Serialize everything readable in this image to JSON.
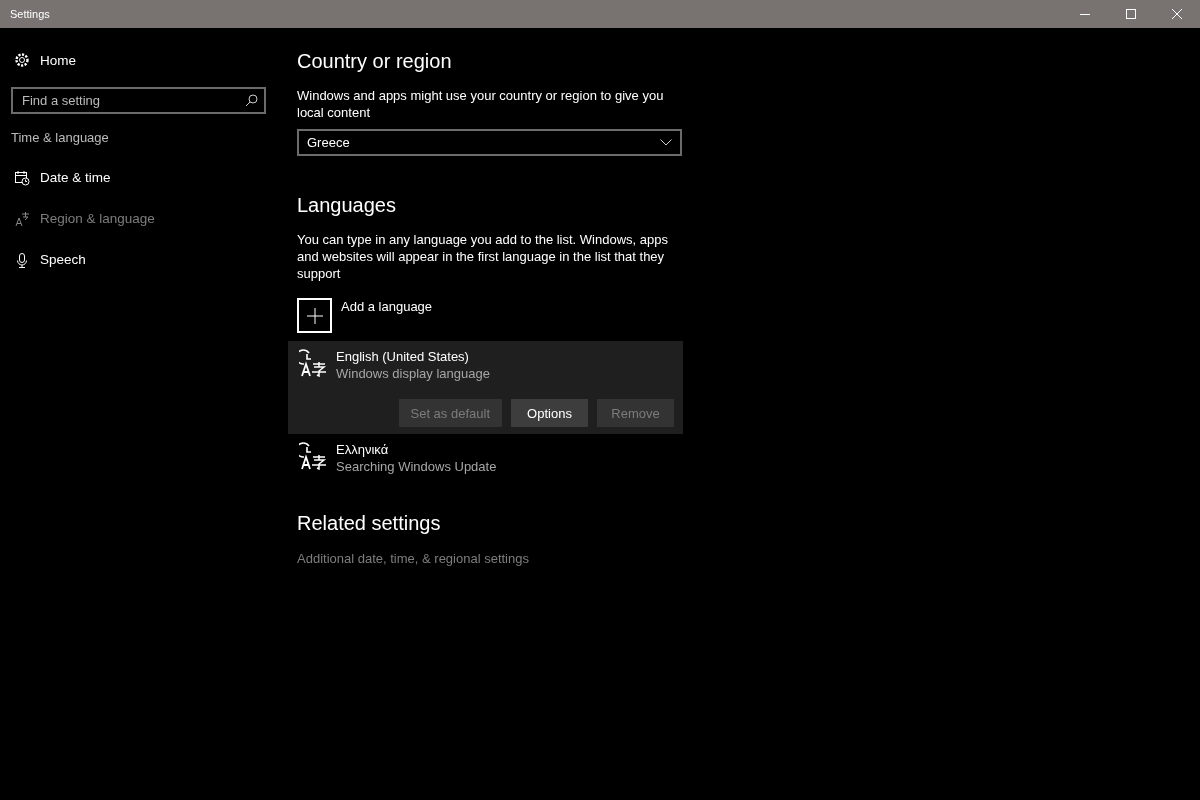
{
  "window": {
    "title": "Settings"
  },
  "sidebar": {
    "home": "Home",
    "search": {
      "placeholder": "Find a setting"
    },
    "section": "Time & language",
    "items": [
      {
        "label": "Date & time",
        "kind": "date",
        "selected": false
      },
      {
        "label": "Region & language",
        "kind": "region",
        "selected": true
      },
      {
        "label": "Speech",
        "kind": "speech",
        "selected": false
      }
    ]
  },
  "country": {
    "heading": "Country or region",
    "description": "Windows and apps might use your country or region to give you local content",
    "value": "Greece"
  },
  "languages": {
    "heading": "Languages",
    "description": "You can type in any language you add to the list. Windows, apps and websites will appear in the first language in the list that they support",
    "add_label": "Add a language",
    "items": [
      {
        "name": "English (United States)",
        "status": "Windows display language",
        "selected": true,
        "buttons": [
          {
            "label": "Set as default",
            "disabled": true
          },
          {
            "label": "Options",
            "disabled": false
          },
          {
            "label": "Remove",
            "disabled": true
          }
        ]
      },
      {
        "name": "Ελληνικά",
        "status": "Searching Windows Update",
        "selected": false
      }
    ]
  },
  "related": {
    "heading": "Related settings",
    "link": "Additional date, time, & regional settings"
  }
}
